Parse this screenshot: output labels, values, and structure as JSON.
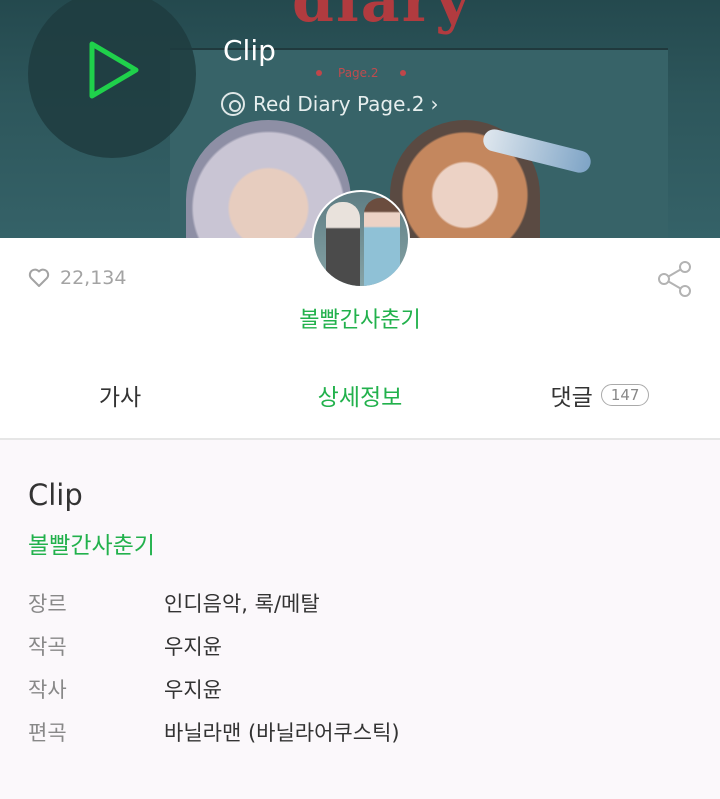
{
  "header": {
    "song_title": "Clip",
    "album_name": "Red Diary Page.2",
    "album_chevron": "›",
    "art_text": "diary",
    "art_page": "Page.2"
  },
  "stats": {
    "likes": "22,134"
  },
  "artist": {
    "name": "볼빨간사춘기"
  },
  "tabs": [
    {
      "label": "가사"
    },
    {
      "label": "상세정보"
    },
    {
      "label": "댓글",
      "count": "147"
    }
  ],
  "details": {
    "title": "Clip",
    "artist": "볼빨간사춘기",
    "rows": [
      {
        "key": "장르",
        "value": "인디음악, 록/메탈"
      },
      {
        "key": "작곡",
        "value": "우지윤"
      },
      {
        "key": "작사",
        "value": "우지윤"
      },
      {
        "key": "편곡",
        "value": "바닐라맨 (바닐라어쿠스틱)"
      }
    ]
  },
  "colors": {
    "accent": "#22b14c",
    "header_bg": "#2d565b",
    "play_icon": "#1fd14b"
  },
  "icons": [
    "play-icon",
    "album-disc-icon",
    "heart-icon",
    "share-icon"
  ]
}
